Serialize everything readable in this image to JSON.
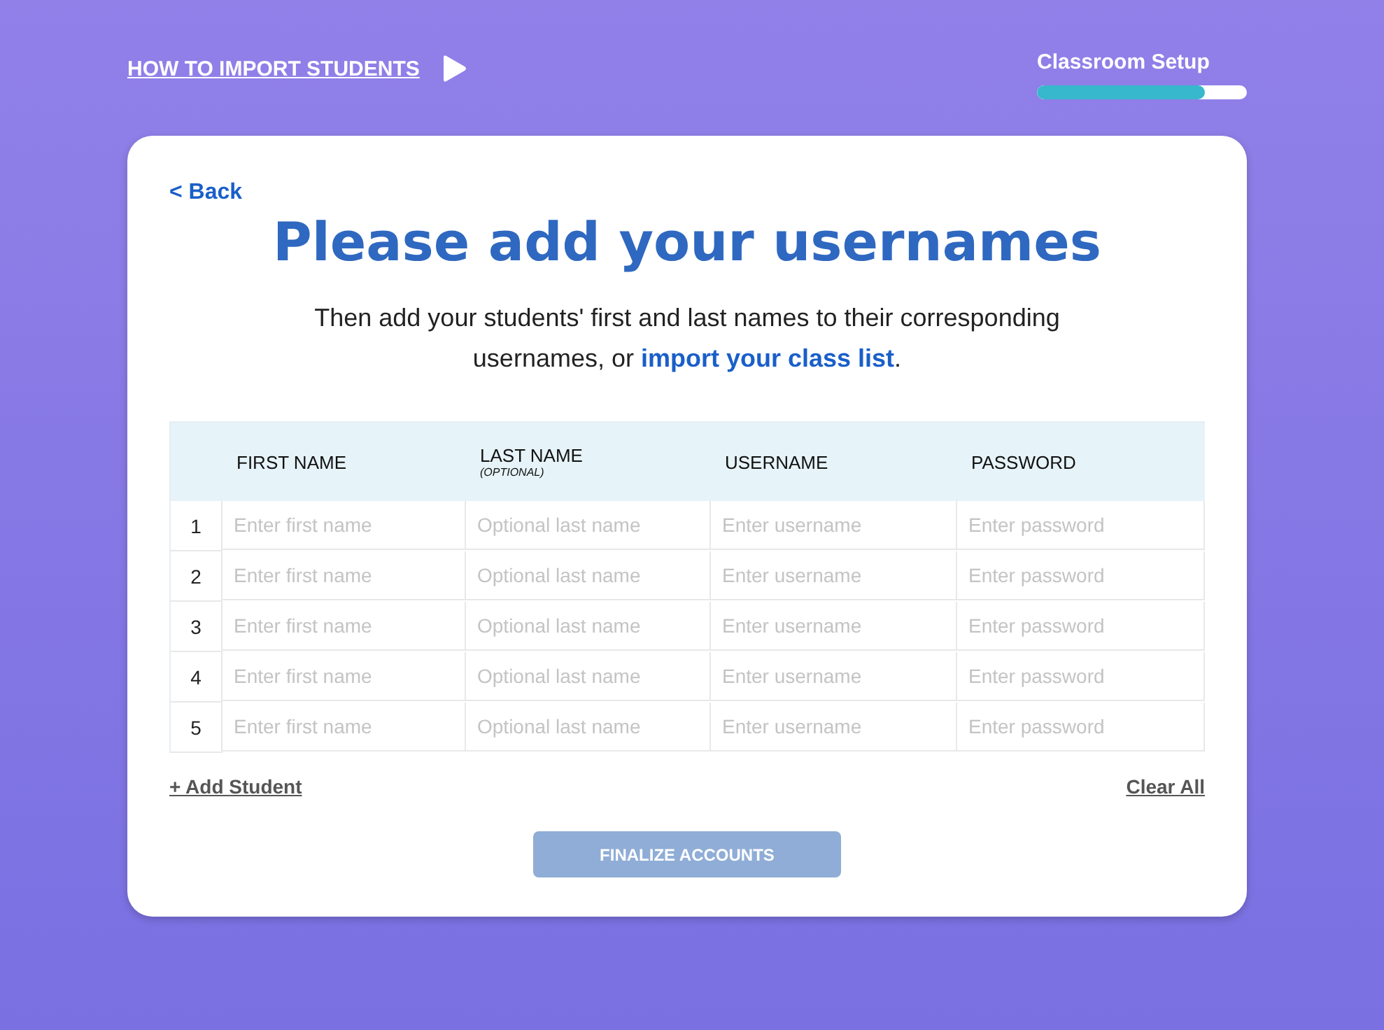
{
  "header": {
    "guide_link": "HOW TO IMPORT STUDENTS",
    "progress": {
      "label": "Classroom Setup",
      "level": 0.8
    }
  },
  "card": {
    "back_link": "< Back",
    "title": "Please add your usernames",
    "intro": "Then add your students' first and last names to their corresponding usernames, or ",
    "intro_link": "import your class list",
    "intro_end": "."
  },
  "table": {
    "columns": [
      {
        "label": "FIRST NAME"
      },
      {
        "label": "LAST NAME",
        "note": "(OPTIONAL)"
      },
      {
        "label": "USERNAME"
      },
      {
        "label": "PASSWORD"
      }
    ],
    "rows": [
      {
        "number": "1",
        "placeholders": [
          "Enter first name",
          "Optional last name",
          "Enter username",
          "Enter password"
        ]
      },
      {
        "number": "2",
        "placeholders": [
          "Enter first name",
          "Optional last name",
          "Enter username",
          "Enter password"
        ]
      },
      {
        "number": "3",
        "placeholders": [
          "Enter first name",
          "Optional last name",
          "Enter username",
          "Enter password"
        ]
      },
      {
        "number": "4",
        "placeholders": [
          "Enter first name",
          "Optional last name",
          "Enter username",
          "Enter password"
        ]
      },
      {
        "number": "5",
        "placeholders": [
          "Enter first name",
          "Optional last name",
          "Enter username",
          "Enter password"
        ]
      }
    ]
  },
  "actions": {
    "add": "+ Add Student",
    "clear": "Clear All"
  },
  "finalize": {
    "label": "FINALIZE ACCOUNTS",
    "disabled": true
  }
}
